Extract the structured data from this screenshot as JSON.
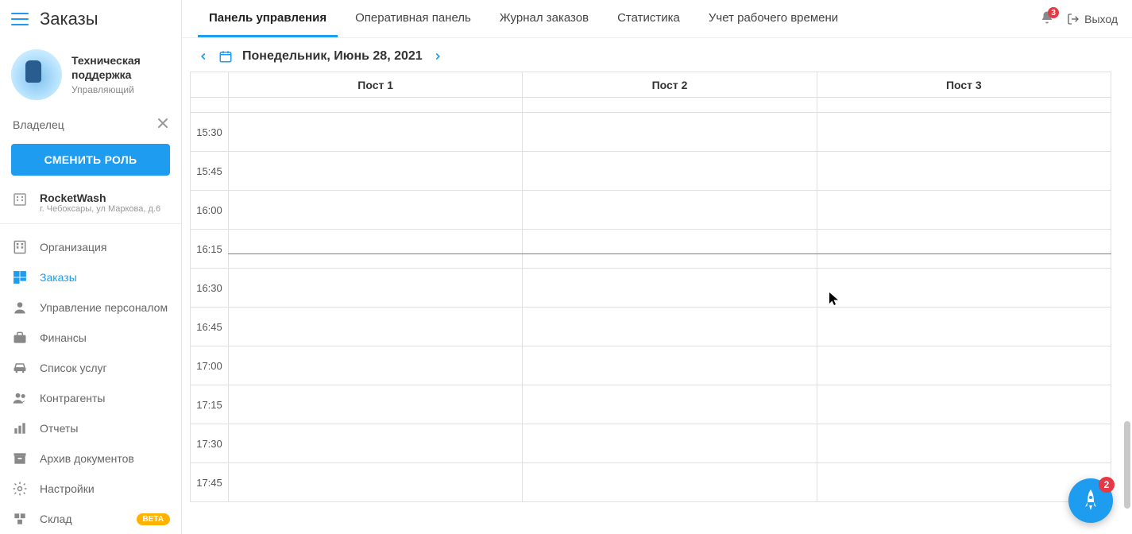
{
  "page_title": "Заказы",
  "user": {
    "name_line1": "Техническая",
    "name_line2": "поддержка",
    "role": "Управляющий"
  },
  "owner_label": "Владелец",
  "switch_role_btn": "СМЕНИТЬ РОЛЬ",
  "org": {
    "name": "RocketWash",
    "address": "г. Чебоксары, ул Маркова, д.6"
  },
  "nav": [
    {
      "key": "organization",
      "label": "Организация",
      "icon": "building",
      "active": false
    },
    {
      "key": "orders",
      "label": "Заказы",
      "icon": "grid",
      "active": true
    },
    {
      "key": "staff",
      "label": "Управление персоналом",
      "icon": "user",
      "active": false
    },
    {
      "key": "finance",
      "label": "Финансы",
      "icon": "briefcase",
      "active": false
    },
    {
      "key": "services",
      "label": "Список услуг",
      "icon": "car",
      "active": false
    },
    {
      "key": "contractors",
      "label": "Контрагенты",
      "icon": "users",
      "active": false
    },
    {
      "key": "reports",
      "label": "Отчеты",
      "icon": "chart",
      "active": false
    },
    {
      "key": "archive",
      "label": "Архив документов",
      "icon": "archive",
      "active": false
    },
    {
      "key": "settings",
      "label": "Настройки",
      "icon": "gear",
      "active": false
    },
    {
      "key": "warehouse",
      "label": "Склад",
      "icon": "boxes",
      "active": false,
      "badge": "BETA"
    }
  ],
  "tabs": [
    {
      "key": "dashboard",
      "label": "Панель управления",
      "active": true
    },
    {
      "key": "operational",
      "label": "Оперативная панель",
      "active": false
    },
    {
      "key": "journal",
      "label": "Журнал заказов",
      "active": false
    },
    {
      "key": "stats",
      "label": "Статистика",
      "active": false
    },
    {
      "key": "worktime",
      "label": "Учет рабочего времени",
      "active": false
    }
  ],
  "notifications_badge": "3",
  "logout_label": "Выход",
  "date_label": "Понедельник, Июнь 28, 2021",
  "posts": [
    "Пост 1",
    "Пост 2",
    "Пост 3"
  ],
  "time_slots": [
    "15:30",
    "15:45",
    "16:00",
    "16:15",
    "16:30",
    "16:45",
    "17:00",
    "17:15",
    "17:30",
    "17:45"
  ],
  "fab_badge": "2"
}
